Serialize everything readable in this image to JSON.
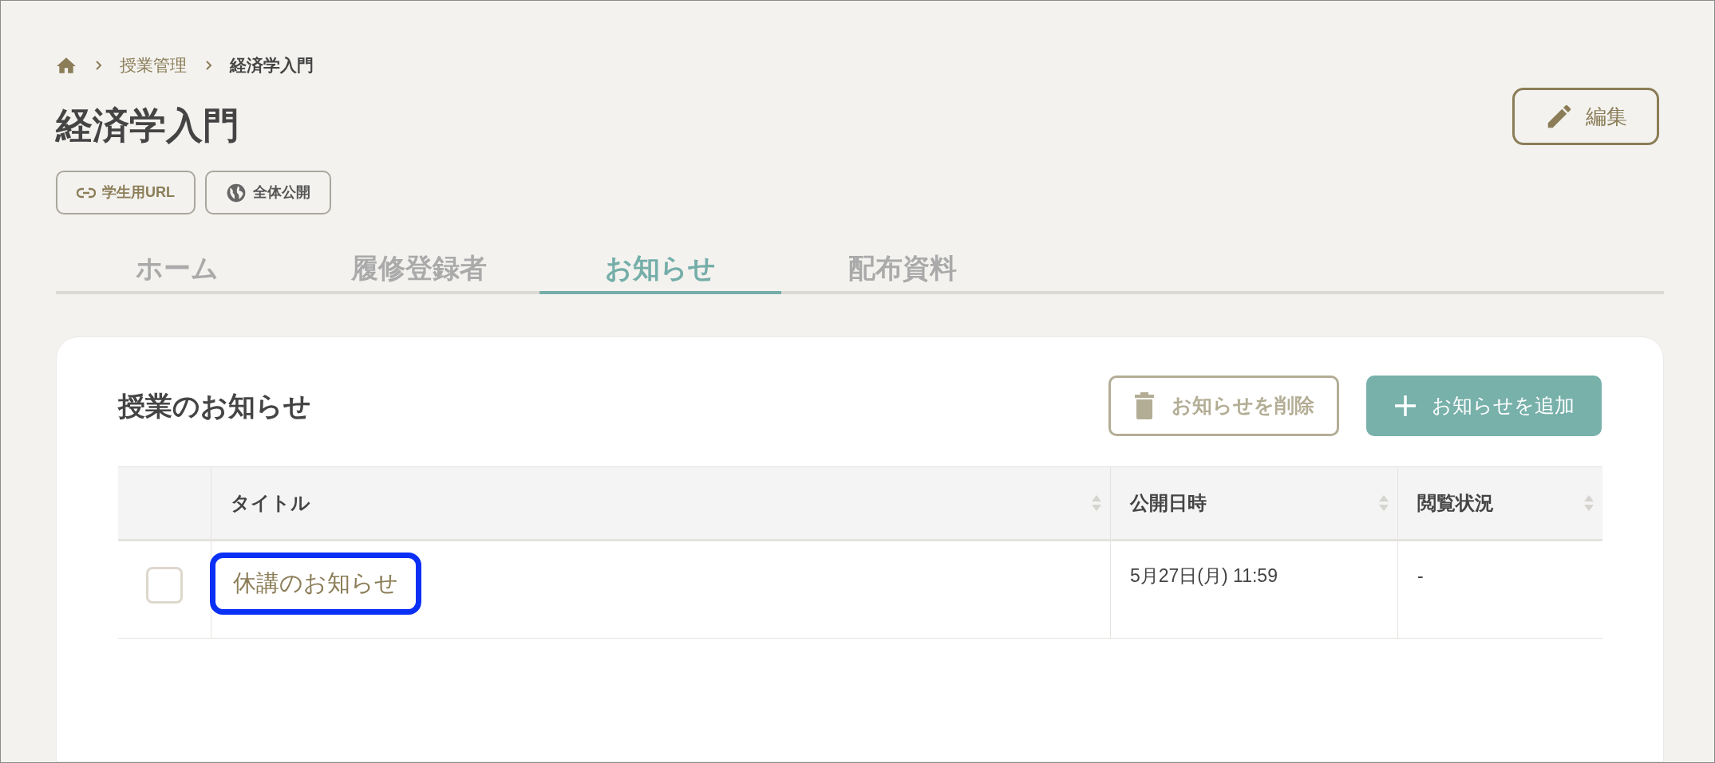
{
  "breadcrumb": [
    {
      "label": "授業管理",
      "current": false
    },
    {
      "label": "経済学入門",
      "current": true
    }
  ],
  "title": "経済学入門",
  "edit_button": "編集",
  "chips": [
    {
      "kind": "link",
      "label": "学生用URL"
    },
    {
      "kind": "globe",
      "label": "全体公開"
    }
  ],
  "tabs": [
    {
      "label": "ホーム",
      "selected": false
    },
    {
      "label": "履修登録者",
      "selected": false
    },
    {
      "label": "お知らせ",
      "selected": true
    },
    {
      "label": "配布資料",
      "selected": false
    }
  ],
  "card": {
    "title": "授業のお知らせ",
    "delete_button": "お知らせを削除",
    "add_button": "お知らせを追加"
  },
  "table": {
    "columns": [
      "タイトル",
      "公開日時",
      "閲覧状況"
    ],
    "rows": [
      {
        "checked": false,
        "highlighted": true,
        "title": "休講のお知らせ",
        "date": "5月27日(月) 11:59",
        "status": "-"
      }
    ]
  }
}
